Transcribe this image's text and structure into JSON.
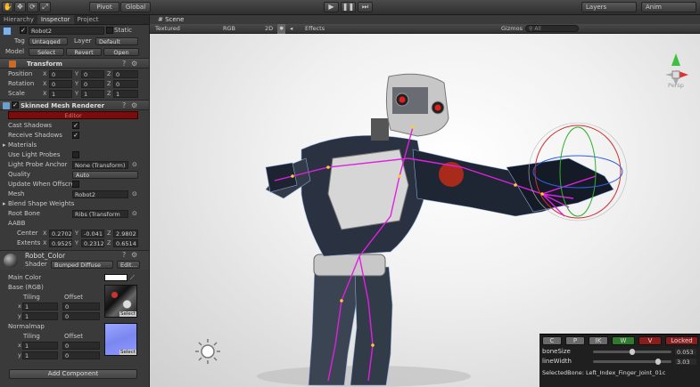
{
  "toolbar": {
    "tool_icons": [
      "hand-icon",
      "move-icon",
      "rotate-icon",
      "scale-icon"
    ],
    "pivot_label": "Pivot",
    "global_label": "Global",
    "layers_label": "Layers",
    "layout_label": "Anim"
  },
  "inspector": {
    "tabs": [
      "Hierarchy",
      "Inspector",
      "Project"
    ],
    "object": {
      "name": "Robot2",
      "static_label": "Static",
      "tag_label": "Tag",
      "tag_value": "Untagged",
      "layer_label": "Layer",
      "layer_value": "Default",
      "model_label": "Model",
      "select_label": "Select",
      "revert_label": "Revert",
      "open_label": "Open"
    },
    "transform": {
      "title": "Transform",
      "rows": [
        {
          "label": "Position",
          "x": "0",
          "y": "0",
          "z": "0"
        },
        {
          "label": "Rotation",
          "x": "0",
          "y": "0",
          "z": "0"
        },
        {
          "label": "Scale",
          "x": "1",
          "y": "1",
          "z": "1"
        }
      ]
    },
    "skinned": {
      "title": "Skinned Mesh Renderer",
      "bar_text": "Editor",
      "cast_shadows": "Cast Shadows",
      "receive_shadows": "Receive Shadows",
      "materials": "Materials",
      "use_light_probes": "Use Light Probes",
      "light_probe_anchor": "Light Probe Anchor",
      "light_probe_anchor_value": "None (Transform)",
      "quality": "Quality",
      "quality_value": "Auto",
      "update_offscreen": "Update When Offscre",
      "mesh": "Mesh",
      "mesh_value": "Robot2",
      "blend_shape": "Blend Shape Weights",
      "root_bone": "Root Bone",
      "root_bone_value": "Ribs (Transform",
      "aabb": "AABB",
      "center_label": "Center",
      "center": {
        "x": "0.2702",
        "y": "-0.041",
        "z": "2.9802"
      },
      "extents_label": "Extents",
      "extents": {
        "x": "0.9525",
        "y": "0.2312",
        "z": "0.6514"
      }
    },
    "material": {
      "name": "Robot_Color",
      "shader_label": "Shader",
      "shader_value": "Bumped Diffuse",
      "edit_label": "Edit...",
      "main_color": "Main Color",
      "base_label": "Base (RGB)",
      "tiling": "Tiling",
      "offset": "Offset",
      "base_tiling": {
        "x": "1",
        "y": "1"
      },
      "base_offset": {
        "x": "0",
        "y": "0"
      },
      "normalmap_label": "Normalmap",
      "normal_tiling": {
        "x": "1",
        "y": "1"
      },
      "normal_offset": {
        "x": "0",
        "y": "0"
      },
      "select_label": "Select",
      "add_component": "Add Component"
    }
  },
  "scene": {
    "tab": "Scene",
    "render_mode": "Textured",
    "color_mode": "RGB",
    "mode_2d": "2D",
    "effects": "Effects",
    "gizmos": "Gizmos",
    "search_placeholder": "All",
    "persp": "Persp",
    "bone_panel": {
      "buttons": [
        "C",
        "P",
        "IK",
        "W",
        "V",
        "Locked"
      ],
      "bone_size_label": "boneSize",
      "bone_size_value": "0.053",
      "bone_size_fraction": 0.5,
      "line_width_label": "lineWidth",
      "line_width_value": "3.03",
      "line_width_fraction": 0.85,
      "selected_bone": "SelectedBone: Left_Index_Finger_Joint_01c"
    }
  },
  "colors": {
    "accent_red": "#7a0c0c",
    "bone_magenta": "#e020e0",
    "locked_red": "#8a1c1c",
    "w_green": "#2f7a2f"
  }
}
